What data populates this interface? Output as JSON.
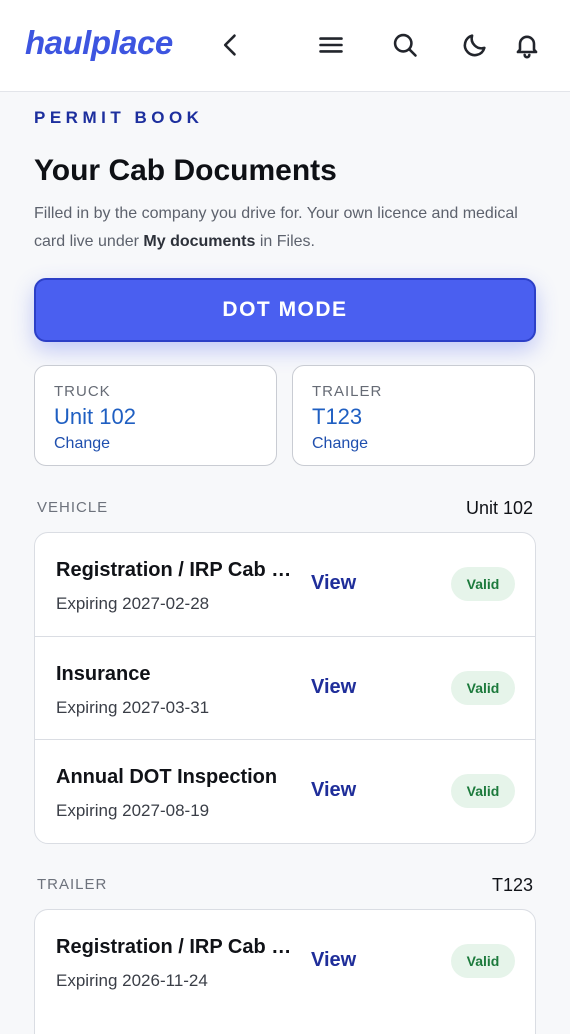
{
  "header": {
    "logo": "haulplace",
    "icons": [
      "back-icon",
      "menu-icon",
      "search-icon",
      "moon-icon",
      "bell-icon"
    ]
  },
  "page": {
    "eyebrow": "PERMIT BOOK",
    "title": "Your Cab Documents",
    "subtitle_part1": "Filled in by the company you drive for. Your own licence and medical card live under ",
    "subtitle_bold": "My documents",
    "subtitle_part2": " in Files.",
    "dot_mode_label": "DOT MODE"
  },
  "selectors": {
    "truck": {
      "label": "TRUCK",
      "value": "Unit 102",
      "change": "Change"
    },
    "trailer": {
      "label": "TRAILER",
      "value": "T123",
      "change": "Change"
    }
  },
  "vehicle_section": {
    "heading": "VEHICLE",
    "unit": "Unit 102",
    "docs": [
      {
        "name": "Registration / IRP Cab Card",
        "expiry": "Expiring 2027-02-28",
        "view": "View",
        "status": "Valid"
      },
      {
        "name": "Insurance",
        "expiry": "Expiring 2027-03-31",
        "view": "View",
        "status": "Valid"
      },
      {
        "name": "Annual DOT Inspection",
        "expiry": "Expiring 2027-08-19",
        "view": "View",
        "status": "Valid"
      }
    ]
  },
  "trailer_section": {
    "heading": "TRAILER",
    "unit": "T123",
    "docs": [
      {
        "name": "Registration / IRP Cab Card",
        "expiry": "Expiring 2026-11-24",
        "view": "View",
        "status": "Valid"
      }
    ]
  },
  "colors": {
    "brand": "#3d55e0",
    "dot_button": "#4a5ff0",
    "link": "#1f2e9a",
    "valid_bg": "#e6f4ea",
    "valid_text": "#1c7a3c"
  }
}
